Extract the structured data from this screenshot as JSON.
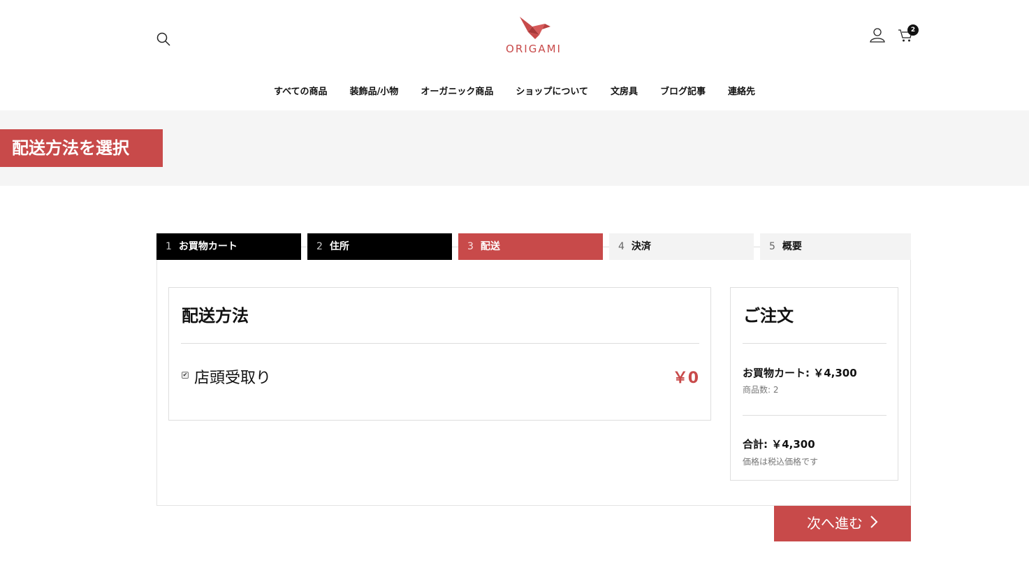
{
  "header": {
    "logo_text": "ORIGAMI",
    "cart_count": "2",
    "brand_color": "#c84a4a",
    "icons": [
      "search-icon",
      "user-icon",
      "cart-icon"
    ]
  },
  "nav": {
    "items": [
      {
        "label": "すべての商品"
      },
      {
        "label": "装飾品/小物"
      },
      {
        "label": "オーガニック商品"
      },
      {
        "label": "ショップについて"
      },
      {
        "label": "文房具"
      },
      {
        "label": "ブログ記事"
      },
      {
        "label": "連絡先"
      }
    ]
  },
  "page": {
    "title": "配送方法を選択"
  },
  "steps": [
    {
      "num": "1",
      "label": "お買物カート",
      "state": "done"
    },
    {
      "num": "2",
      "label": "住所",
      "state": "done"
    },
    {
      "num": "3",
      "label": "配送",
      "state": "active"
    },
    {
      "num": "4",
      "label": "決済",
      "state": "todo"
    },
    {
      "num": "5",
      "label": "概要",
      "state": "todo"
    }
  ],
  "shipping": {
    "title": "配送方法",
    "method": "店頭受取り",
    "price": "￥0",
    "checked": true
  },
  "order": {
    "title": "ご注文",
    "cart_line": "お買物カート: ￥4,300",
    "item_count": "商品数: 2",
    "total_line": "合計: ￥4,300",
    "tax_note": "価格は税込価格です"
  },
  "actions": {
    "next_label": "次へ進む"
  }
}
